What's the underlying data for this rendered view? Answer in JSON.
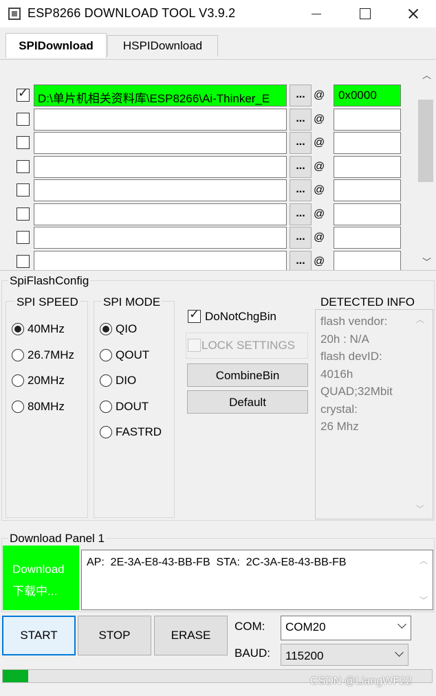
{
  "window": {
    "title": "ESP8266 DOWNLOAD TOOL V3.9.2"
  },
  "tabs": [
    {
      "label": "SPIDownload",
      "active": true
    },
    {
      "label": "HSPIDownload",
      "active": false
    }
  ],
  "files": {
    "browse_label": "...",
    "at_label": "@",
    "rows": [
      {
        "checked": true,
        "path": "D:\\单片机相关资料库\\ESP8266\\Ai-Thinker_E",
        "address": "0x0000"
      },
      {
        "checked": false,
        "path": "",
        "address": ""
      },
      {
        "checked": false,
        "path": "",
        "address": ""
      },
      {
        "checked": false,
        "path": "",
        "address": ""
      },
      {
        "checked": false,
        "path": "",
        "address": ""
      },
      {
        "checked": false,
        "path": "",
        "address": ""
      },
      {
        "checked": false,
        "path": "",
        "address": ""
      },
      {
        "checked": false,
        "path": "",
        "address": ""
      }
    ]
  },
  "spi_flash_config": {
    "title": "SpiFlashConfig",
    "spi_speed": {
      "title": "SPI SPEED",
      "options": [
        "40MHz",
        "26.7MHz",
        "20MHz",
        "80MHz"
      ],
      "selected": "40MHz"
    },
    "spi_mode": {
      "title": "SPI MODE",
      "options": [
        "QIO",
        "QOUT",
        "DIO",
        "DOUT",
        "FASTRD"
      ],
      "selected": "QIO"
    },
    "do_not_chg_bin": {
      "label": "DoNotChgBin",
      "checked": true
    },
    "lock_settings": {
      "label": "LOCK SETTINGS",
      "checked": false,
      "enabled": false
    },
    "combine_bin_label": "CombineBin",
    "default_label": "Default",
    "detected_info": {
      "title": "DETECTED INFO",
      "lines": [
        "flash vendor:",
        "20h : N/A",
        "flash devID:",
        "4016h",
        "QUAD;32Mbit",
        "crystal:",
        "26 Mhz"
      ]
    }
  },
  "download_panel": {
    "title": "Download Panel 1",
    "status_line1": "Download",
    "status_line2": "下载中...",
    "status_color": "#00ff00",
    "log": "AP:  2E-3A-E8-43-BB-FB  STA:  2C-3A-E8-43-BB-FB",
    "start_label": "START",
    "stop_label": "STOP",
    "erase_label": "ERASE",
    "com_label": "COM:",
    "com_value": "COM20",
    "baud_label": "BAUD:",
    "baud_value": "115200",
    "progress": 0.06,
    "progress_color": "#06b025"
  },
  "watermark": "CSDN @LiangWF22"
}
